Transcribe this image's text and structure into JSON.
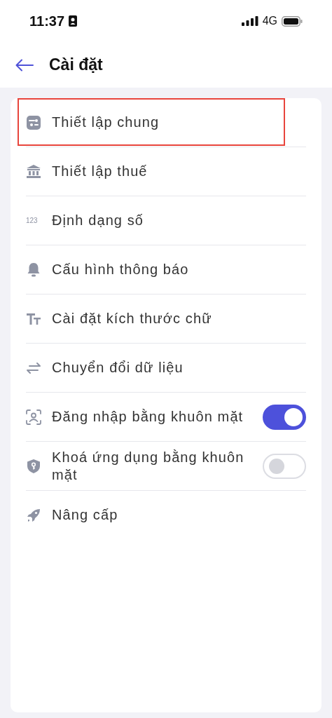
{
  "status_bar": {
    "time": "11:37",
    "network": "4G"
  },
  "header": {
    "title": "Cài đặt"
  },
  "items": [
    {
      "kind": "link",
      "label": "Thiết lập chung",
      "highlighted": true
    },
    {
      "kind": "link",
      "label": "Thiết lập thuế",
      "highlighted": false
    },
    {
      "kind": "link",
      "label": "Định dạng số",
      "icon_text": "123",
      "highlighted": false
    },
    {
      "kind": "link",
      "label": "Cấu hình thông báo",
      "highlighted": false
    },
    {
      "kind": "link",
      "label": "Cài đặt kích thước chữ",
      "highlighted": false
    },
    {
      "kind": "link",
      "label": "Chuyển đổi dữ liệu",
      "highlighted": false
    },
    {
      "kind": "toggle",
      "label": "Đăng nhập bằng khuôn mặt",
      "on": true,
      "highlighted": false
    },
    {
      "kind": "toggle",
      "label": "Khoá ứng dụng bằng khuôn mặt",
      "on": false,
      "highlighted": false
    },
    {
      "kind": "link",
      "label": "Nâng cấp",
      "highlighted": false
    }
  ]
}
